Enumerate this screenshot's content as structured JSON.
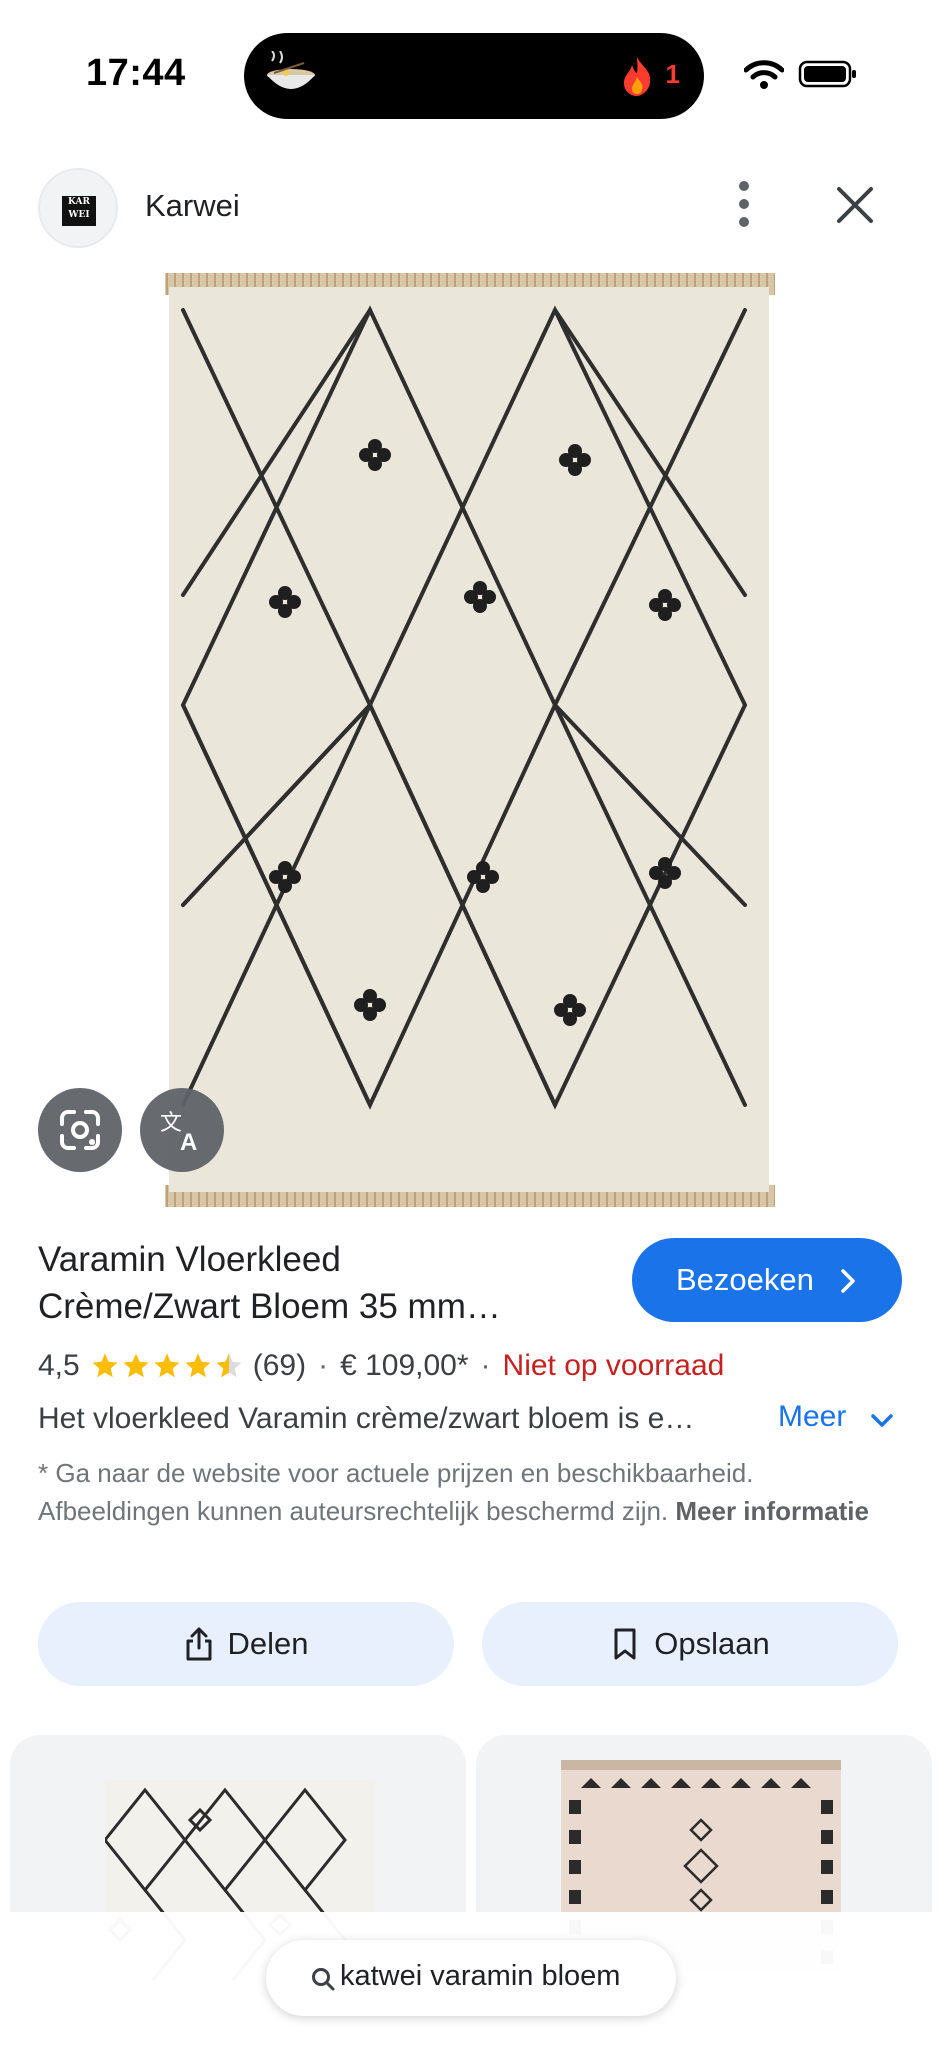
{
  "status_bar": {
    "time": "17:44",
    "notification_count": "1"
  },
  "header": {
    "site_name": "Karwei",
    "logo_text": "KAR WEI"
  },
  "product": {
    "title_line1": "Varamin Vloerkleed",
    "title_line2": "Crème/Zwart Bloem 35 mm…",
    "visit_label": "Bezoeken",
    "rating": "4,5",
    "rating_value": 4.5,
    "rating_max": 5,
    "review_count": "(69)",
    "price": "€ 109,00*",
    "stock_status": "Niet op voorraad",
    "description": "Het vloerkleed Varamin crème/zwart bloem is e…",
    "more_label": "Meer",
    "disclaimer": "* Ga naar de website voor actuele prijzen en beschikbaarheid. Afbeeldingen kunnen auteursrechtelijk beschermd zijn.",
    "more_info_label": "Meer informatie"
  },
  "actions": {
    "share_label": "Delen",
    "save_label": "Opslaan"
  },
  "search": {
    "query": "katwei varamin bloem"
  },
  "icons": {
    "more": "more-vert-icon",
    "close": "close-icon",
    "lens": "lens-icon",
    "translate": "translate-icon",
    "share": "share-icon",
    "bookmark": "bookmark-icon",
    "search": "search-icon",
    "chevron_right": "chevron-right-icon",
    "chevron_down": "chevron-down-icon"
  },
  "colors": {
    "accent": "#1a73e8",
    "stock_out": "#c5221f",
    "star": "#fbbc04",
    "chip_bg": "#e8f0fe"
  }
}
